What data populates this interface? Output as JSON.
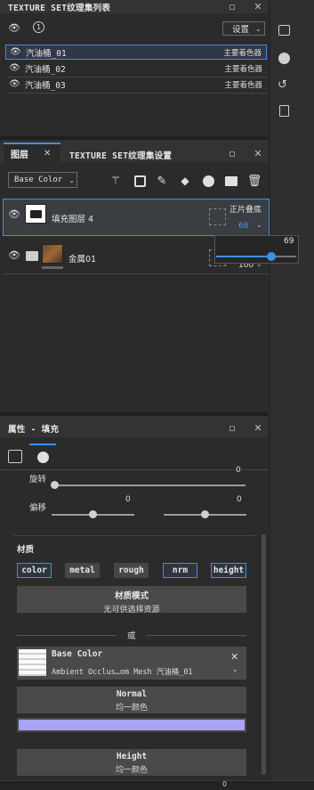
{
  "texture_set_list": {
    "title": "TEXTURE SET纹理集列表",
    "settings_label": "设置",
    "rows": [
      {
        "name": "汽油桶_01",
        "shader": "主要着色器"
      },
      {
        "name": "汽油桶_02",
        "shader": "主要着色器"
      },
      {
        "name": "汽油桶_03",
        "shader": "主要着色器"
      }
    ]
  },
  "layers_panel": {
    "tab_layers": "图层",
    "tab_settings": "TEXTURE SET纹理集设置",
    "channel_select": "Base Color",
    "layers": [
      {
        "name": "填充图层 4",
        "blend": "正片叠底",
        "opacity": "68"
      },
      {
        "name": "金属01",
        "opacity": "100"
      }
    ],
    "opacity_popup": {
      "value": "69",
      "level": 0.69
    }
  },
  "properties_panel": {
    "title": "属性 - 填充",
    "rotation_label": "旋转",
    "rotation_value": "0",
    "offset_label": "偏移",
    "offset_x": "0",
    "offset_y": "0",
    "material_label": "材质",
    "channels": [
      "color",
      "metal",
      "rough",
      "nrm",
      "height"
    ],
    "material_mode_title": "材质模式",
    "material_mode_sub": "无可供选择资源",
    "or_label": "或",
    "base_color": {
      "title": "Base Color",
      "source": "Ambient Occlus…om Mesh 汽油桶_01"
    },
    "normal": {
      "title": "Normal",
      "sub": "均一颜色",
      "swatch_color": "#a7a4f3"
    },
    "height": {
      "title": "Height",
      "sub": "均一颜色"
    },
    "status_value": "0"
  },
  "colors": {
    "accent": "#3f8ee8",
    "panel_bg": "#2b2b2b",
    "header_bg": "#383838"
  }
}
